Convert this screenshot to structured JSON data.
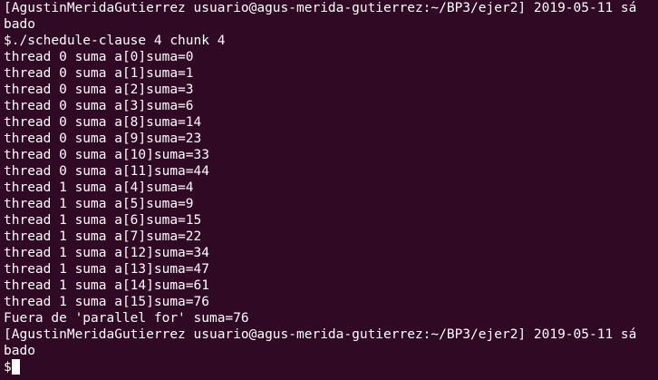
{
  "terminal": {
    "lines": [
      "[AgustinMeridaGutierrez usuario@agus-merida-gutierrez:~/BP3/ejer2] 2019-05-11 sá",
      "bado",
      "$./schedule-clause 4 chunk 4",
      "thread 0 suma a[0]suma=0",
      "thread 0 suma a[1]suma=1",
      "thread 0 suma a[2]suma=3",
      "thread 0 suma a[3]suma=6",
      "thread 0 suma a[8]suma=14",
      "thread 0 suma a[9]suma=23",
      "thread 0 suma a[10]suma=33",
      "thread 0 suma a[11]suma=44",
      "thread 1 suma a[4]suma=4",
      "thread 1 suma a[5]suma=9",
      "thread 1 suma a[6]suma=15",
      "thread 1 suma a[7]suma=22",
      "thread 1 suma a[12]suma=34",
      "thread 1 suma a[13]suma=47",
      "thread 1 suma a[14]suma=61",
      "thread 1 suma a[15]suma=76",
      "Fuera de 'parallel for' suma=76",
      "[AgustinMeridaGutierrez usuario@agus-merida-gutierrez:~/BP3/ejer2] 2019-05-11 sá",
      "bado"
    ],
    "prompt": "$"
  }
}
